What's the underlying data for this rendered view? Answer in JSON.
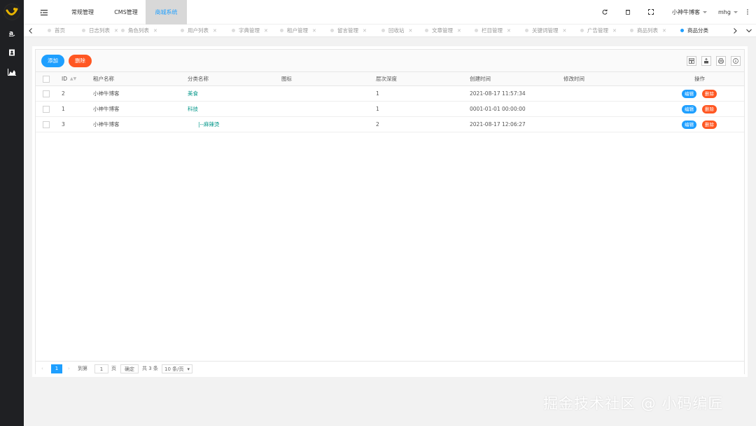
{
  "topnav": {
    "items": [
      "常规管理",
      "CMS管理",
      "商城系统"
    ],
    "active_index": 2,
    "user": "小神牛博客",
    "lang": "mhg"
  },
  "tabs": [
    {
      "label": "首页",
      "active": false
    },
    {
      "label": "日志列表",
      "active": false
    },
    {
      "label": "角色列表",
      "active": false
    },
    {
      "label": "用户列表",
      "active": false
    },
    {
      "label": "字典管理",
      "active": false
    },
    {
      "label": "租户管理",
      "active": false
    },
    {
      "label": "留言管理",
      "active": false
    },
    {
      "label": "回收站",
      "active": false
    },
    {
      "label": "文章管理",
      "active": false
    },
    {
      "label": "栏目管理",
      "active": false
    },
    {
      "label": "关键词管理",
      "active": false
    },
    {
      "label": "广告管理",
      "active": false
    },
    {
      "label": "商品列表",
      "active": false
    },
    {
      "label": "商品分类",
      "active": true
    }
  ],
  "toolbar": {
    "add_label": "添加",
    "delete_label": "删除"
  },
  "table": {
    "columns": [
      "ID",
      "租户名称",
      "分类名称",
      "图标",
      "层次深度",
      "创建时间",
      "修改时间",
      "操作"
    ],
    "rows": [
      {
        "id": "2",
        "tenant": "小神牛博客",
        "name": "美食",
        "icon": "",
        "depth": "1",
        "created": "2021-08-17 11:57:34",
        "updated": ""
      },
      {
        "id": "1",
        "tenant": "小神牛博客",
        "name": "科技",
        "icon": "",
        "depth": "1",
        "created": "0001-01-01 00:00:00",
        "updated": ""
      },
      {
        "id": "3",
        "tenant": "小神牛博客",
        "name": "|--麻辣烫",
        "icon": "",
        "depth": "2",
        "created": "2021-08-17 12:06:27",
        "updated": ""
      }
    ],
    "edit_label": "编辑",
    "delete_label": "删除"
  },
  "pager": {
    "current": "1",
    "goto_label": "到第",
    "page_value": "1",
    "page_unit": "页",
    "confirm_label": "确定",
    "total": "共 3 条",
    "page_size": "10 条/页"
  },
  "watermark": "掘金技术社区 @ 小码编匠",
  "colors": {
    "primary": "#1e9fff",
    "danger": "#ff5722",
    "link_green": "#009688",
    "sidebar": "#1f2023"
  }
}
